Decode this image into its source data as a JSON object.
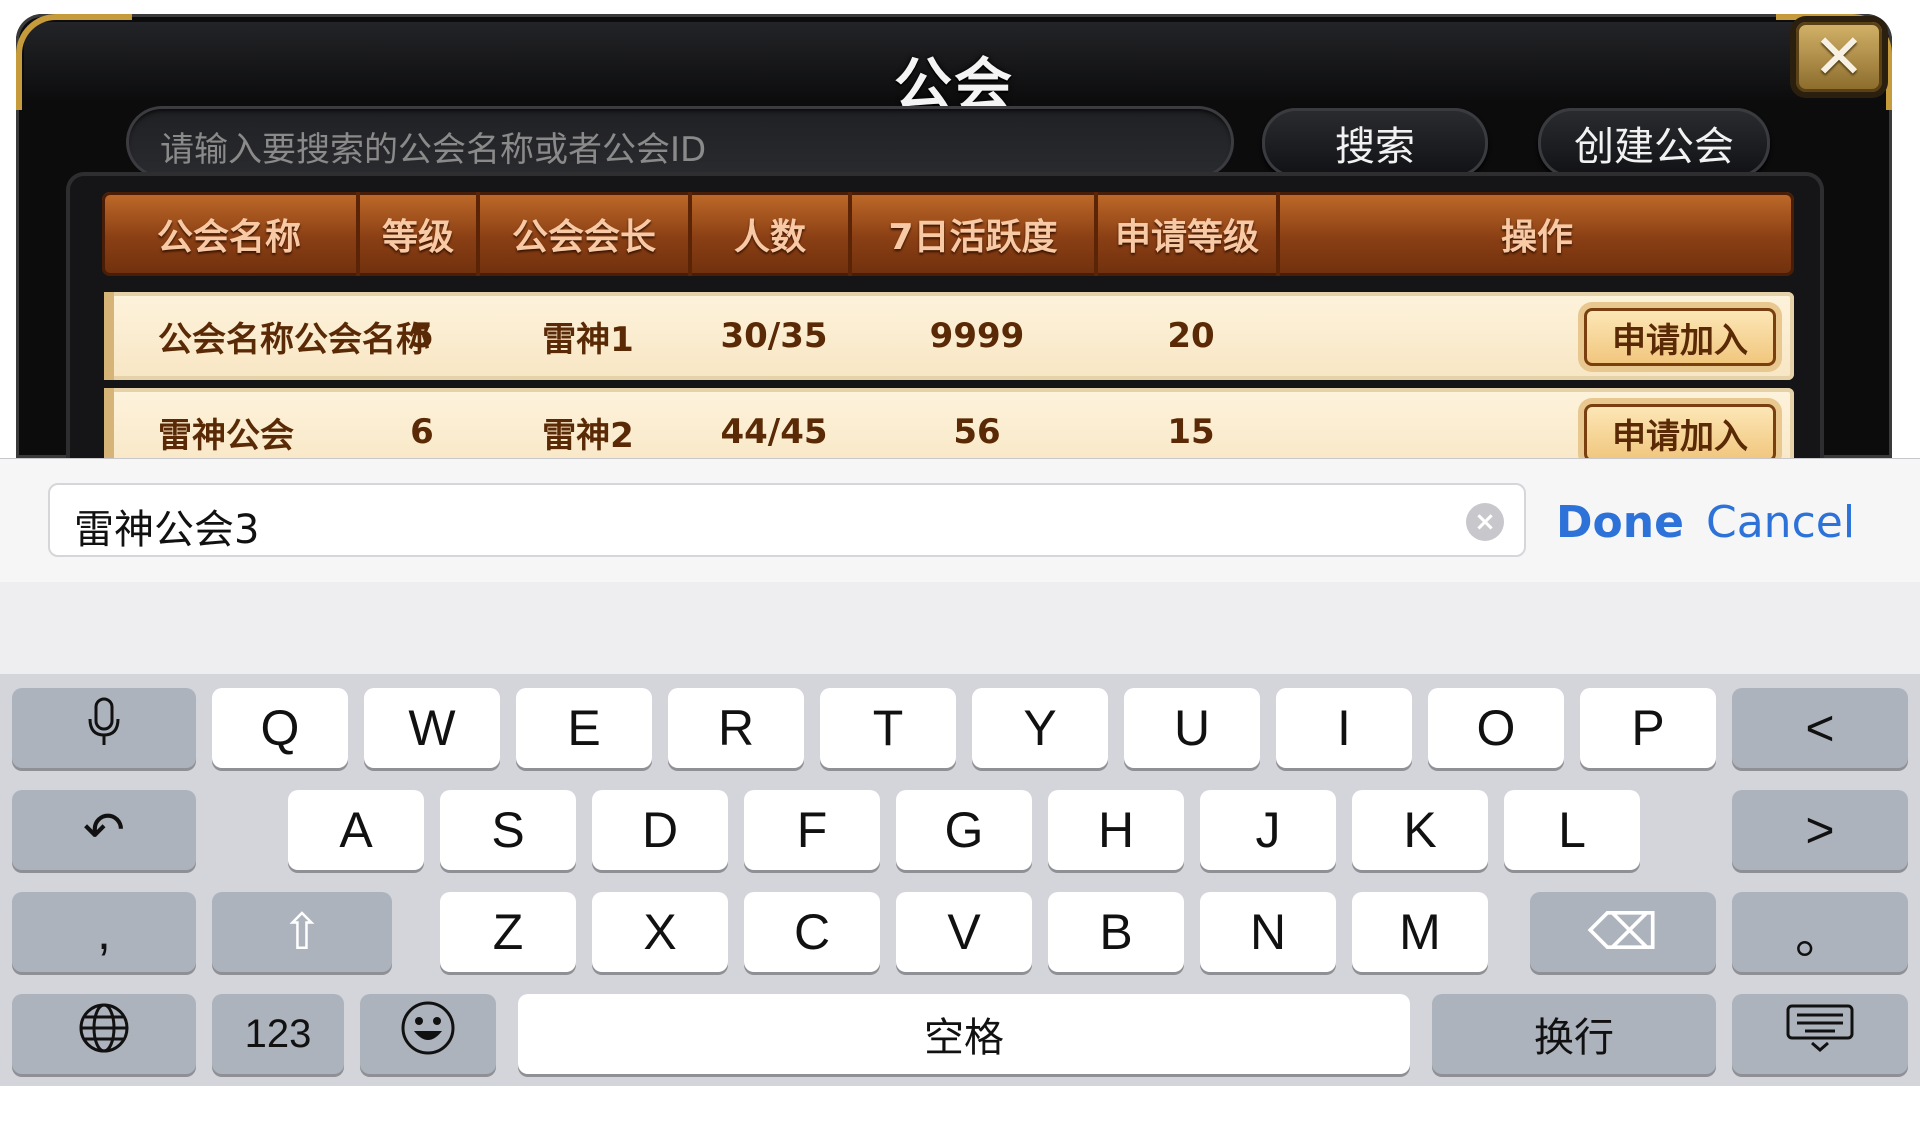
{
  "panel": {
    "title": "公会",
    "close_label": "✕",
    "search_placeholder": "请输入要搜索的公会名称或者公会ID",
    "search_button": "搜索",
    "create_button": "创建公会"
  },
  "table": {
    "headers": [
      "公会名称",
      "等级",
      "公会会长",
      "人数",
      "7日活跃度",
      "申请等级",
      "操作"
    ],
    "rows": [
      {
        "name": "公会名称公会名称",
        "level": "5",
        "leader": "雷神1",
        "members": "30/35",
        "activity": "9999",
        "req_level": "20",
        "action": "申请加入"
      },
      {
        "name": "雷神公会",
        "level": "6",
        "leader": "雷神2",
        "members": "44/45",
        "activity": "56",
        "req_level": "15",
        "action": "申请加入"
      }
    ]
  },
  "input_bar": {
    "value": "雷神公会3",
    "done": "Done",
    "cancel": "Cancel"
  },
  "keyboard": {
    "row1": [
      "Q",
      "W",
      "E",
      "R",
      "T",
      "Y",
      "U",
      "I",
      "O",
      "P"
    ],
    "row2": [
      "A",
      "S",
      "D",
      "F",
      "G",
      "H",
      "J",
      "K",
      "L"
    ],
    "row3": [
      "Z",
      "X",
      "C",
      "V",
      "B",
      "N",
      "M"
    ],
    "left_arrow": "<",
    "right_arrow": ">",
    "undo": "↶",
    "comma": ",",
    "shift": "⇧",
    "backspace": "⌫",
    "period": "。",
    "globe": "🌐",
    "numbers": "123",
    "emoji": "☺",
    "space": "空格",
    "return": "换行",
    "dismiss": "⌨",
    "mic": "🎤"
  }
}
